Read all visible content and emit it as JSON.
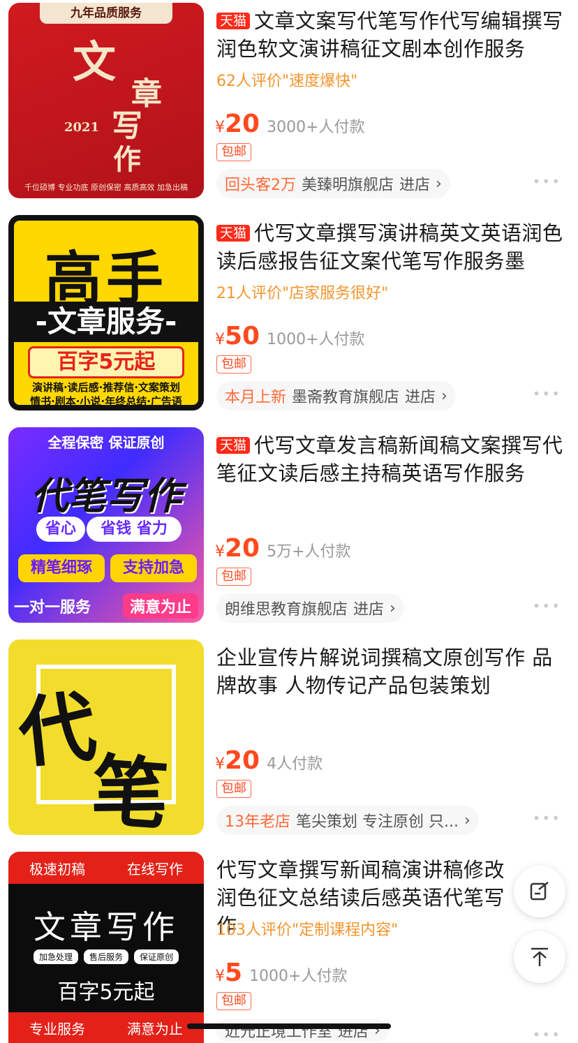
{
  "products": [
    {
      "badge": "天猫",
      "title": "文章文案写代笔写作代写编辑撰写润色软文演讲稿征文剧本创作服务",
      "review": "62人评价\"速度爆快\"",
      "currency": "¥",
      "price": "20",
      "sales": "3000+人付款",
      "shipping": "包邮",
      "store_tag": "回头客2万",
      "store_name": "美臻明旗舰店",
      "enter": "进店",
      "thumb": {
        "band": "九年品质服务",
        "c1": "文",
        "c2": "章",
        "c3": "写",
        "c4": "作",
        "year": "2021",
        "foot": "千位硕博 专业功底 原创保密 高质高效 加急出稿"
      }
    },
    {
      "badge": "天猫",
      "title": "代写文章撰写演讲稿英文英语润色读后感报告征文案代笔写作服务墨",
      "review": "21人评价\"店家服务很好\"",
      "currency": "¥",
      "price": "50",
      "sales": "1000+人付款",
      "shipping": "包邮",
      "store_tag": "本月上新",
      "store_name": "墨斋教育旗舰店",
      "enter": "进店",
      "thumb": {
        "big": "高手",
        "bar": "-文章服务-",
        "mid": "百字5元起",
        "line1": "演讲稿·读后感·推荐信·文案策划",
        "line2": "情书·剧本·小说·年终总结·广告语"
      }
    },
    {
      "badge": "天猫",
      "title": "代写文章发言稿新闻稿文案撰写代笔征文读后感主持稿英语写作服务",
      "review": "",
      "currency": "¥",
      "price": "20",
      "sales": "5万+人付款",
      "shipping": "包邮",
      "store_tag": "",
      "store_name": "朗维思教育旗舰店",
      "enter": "进店",
      "thumb": {
        "top": "全程保密 保证原创",
        "big": "代笔写作",
        "p1": "省心",
        "p2": "省钱 省力",
        "y1": "精笔细琢",
        "y2": "支持加急",
        "bottom": "一对一服务",
        "pink": "满意为止"
      }
    },
    {
      "badge": "",
      "title": "企业宣传片解说词撰稿文原创写作 品牌故事 人物传记产品包装策划",
      "review": "",
      "currency": "¥",
      "price": "20",
      "sales": "4人付款",
      "shipping": "包邮",
      "store_tag": "13年老店",
      "store_name": "笔尖策划 专注原创 只...",
      "enter": "",
      "thumb": {
        "c1": "代",
        "c2": "笔"
      }
    },
    {
      "badge": "",
      "title": "代写文章撰写新闻稿演讲稿修改润色征文总结读后感英语代笔写作",
      "review": "103人评价\"定制课程内容\"",
      "currency": "¥",
      "price": "5",
      "sales": "1000+人付款",
      "shipping": "包邮",
      "store_tag": "",
      "store_name": "近元正境工作室",
      "enter": "进店",
      "thumb": {
        "t1": "极速初稿",
        "t2": "在线写作",
        "big": "文章写作",
        "chip1": "加急处理",
        "chip2": "售后服务",
        "chip3": "保证原创",
        "mid": "百字5元起",
        "b1": "专业服务",
        "b2": "满意为止"
      }
    }
  ],
  "icons": {
    "more": "more-dots-icon",
    "edit": "edit-icon",
    "top": "back-to-top-icon"
  }
}
